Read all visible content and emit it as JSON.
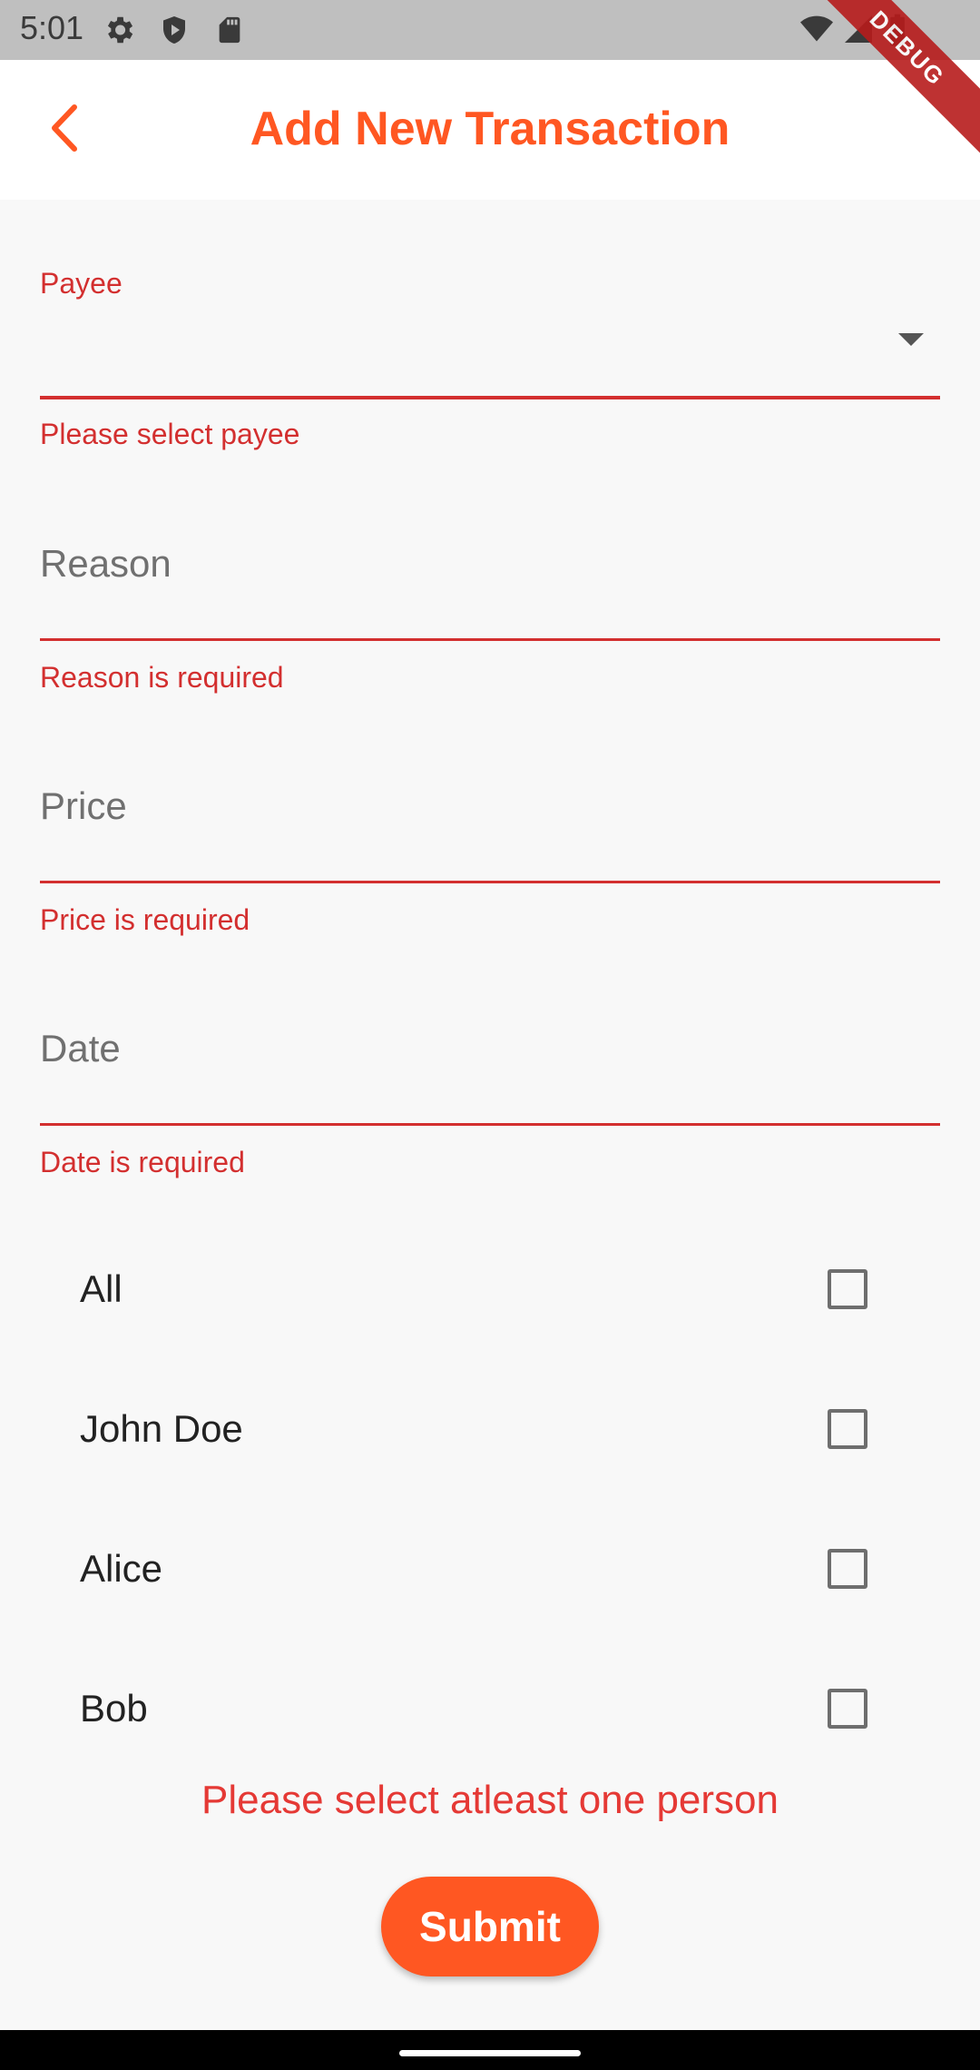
{
  "status_bar": {
    "time": "5:01",
    "icons": [
      "settings-icon",
      "shield-icon",
      "sd-card-icon",
      "wifi-icon",
      "signal-icon",
      "battery-icon"
    ]
  },
  "app_bar": {
    "title": "Add New Transaction",
    "back_icon": "chevron-left-icon",
    "debug_banner": "DEBUG",
    "accent_color": "#ff5722"
  },
  "form": {
    "payee": {
      "label": "Payee",
      "value": "",
      "error": "Please select payee"
    },
    "reason": {
      "placeholder": "Reason",
      "error": "Reason is required"
    },
    "price": {
      "placeholder": "Price",
      "error": "Price is required"
    },
    "date": {
      "placeholder": "Date",
      "error": "Date is required"
    },
    "people": [
      {
        "label": "All",
        "checked": false
      },
      {
        "label": "John Doe",
        "checked": false
      },
      {
        "label": "Alice",
        "checked": false
      },
      {
        "label": "Bob",
        "checked": false
      }
    ],
    "people_error": "Please select atleast one person",
    "submit_label": "Submit",
    "error_color": "#d32f2f"
  }
}
